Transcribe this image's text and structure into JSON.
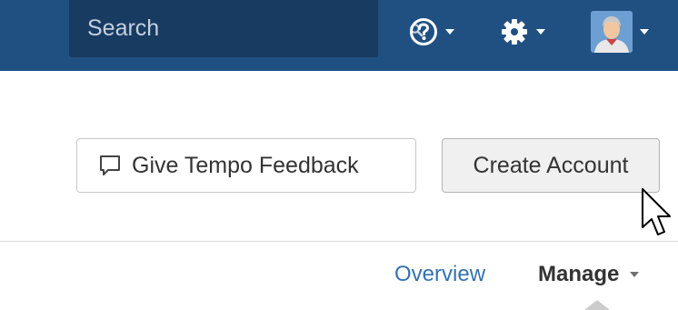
{
  "header": {
    "search": {
      "placeholder": "Search",
      "icon": "search-icon"
    },
    "help": {
      "icon": "help-icon"
    },
    "settings": {
      "icon": "gear-icon"
    },
    "user": {
      "icon": "avatar"
    },
    "colors": {
      "bar": "#205081",
      "search_bg": "#183b62"
    }
  },
  "actions": {
    "feedback_label": "Give Tempo Feedback",
    "feedback_icon": "speech-bubble-icon",
    "create_label": "Create Account"
  },
  "tabs": {
    "overview_label": "Overview",
    "manage_label": "Manage",
    "active": "Manage",
    "link_color": "#3572b0"
  }
}
